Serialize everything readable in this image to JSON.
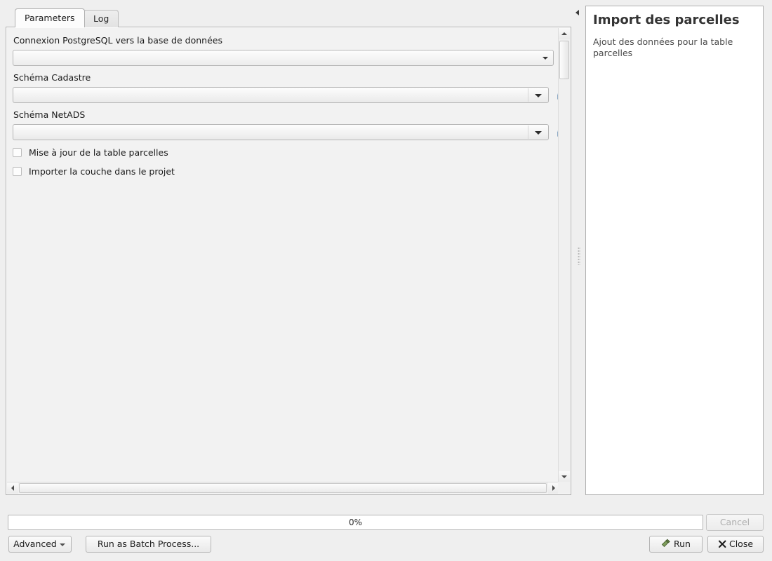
{
  "tabs": [
    {
      "label": "Parameters",
      "active": true
    },
    {
      "label": "Log",
      "active": false
    }
  ],
  "parameters": {
    "connection": {
      "label": "Connexion PostgreSQL vers la base de données",
      "value": "",
      "placeholder": ""
    },
    "schema_cadastre": {
      "label": "Schéma Cadastre",
      "value": "",
      "refresh_tooltip": "refresh-icon"
    },
    "schema_netads": {
      "label": "Schéma NetADS",
      "value": "",
      "refresh_tooltip": "refresh-icon"
    },
    "checkboxes": [
      {
        "label": "Mise à jour de la table parcelles",
        "checked": false
      },
      {
        "label": "Importer la couche dans le projet",
        "checked": false
      }
    ]
  },
  "help": {
    "title": "Import des parcelles",
    "description": "Ajout des données pour la table parcelles"
  },
  "progress": {
    "percent_label": "0%",
    "value": 0
  },
  "buttons": {
    "advanced": "Advanced",
    "batch": "Run as Batch Process...",
    "cancel": "Cancel",
    "run": "Run",
    "close": "Close"
  },
  "colors": {
    "window_bg": "#efefef",
    "panel_bg": "#f2f2f2",
    "help_bg": "#ffffff",
    "border": "#b0b0b0",
    "run_icon": "#6f8c4e",
    "refresh_icon": "#4a86c8"
  }
}
